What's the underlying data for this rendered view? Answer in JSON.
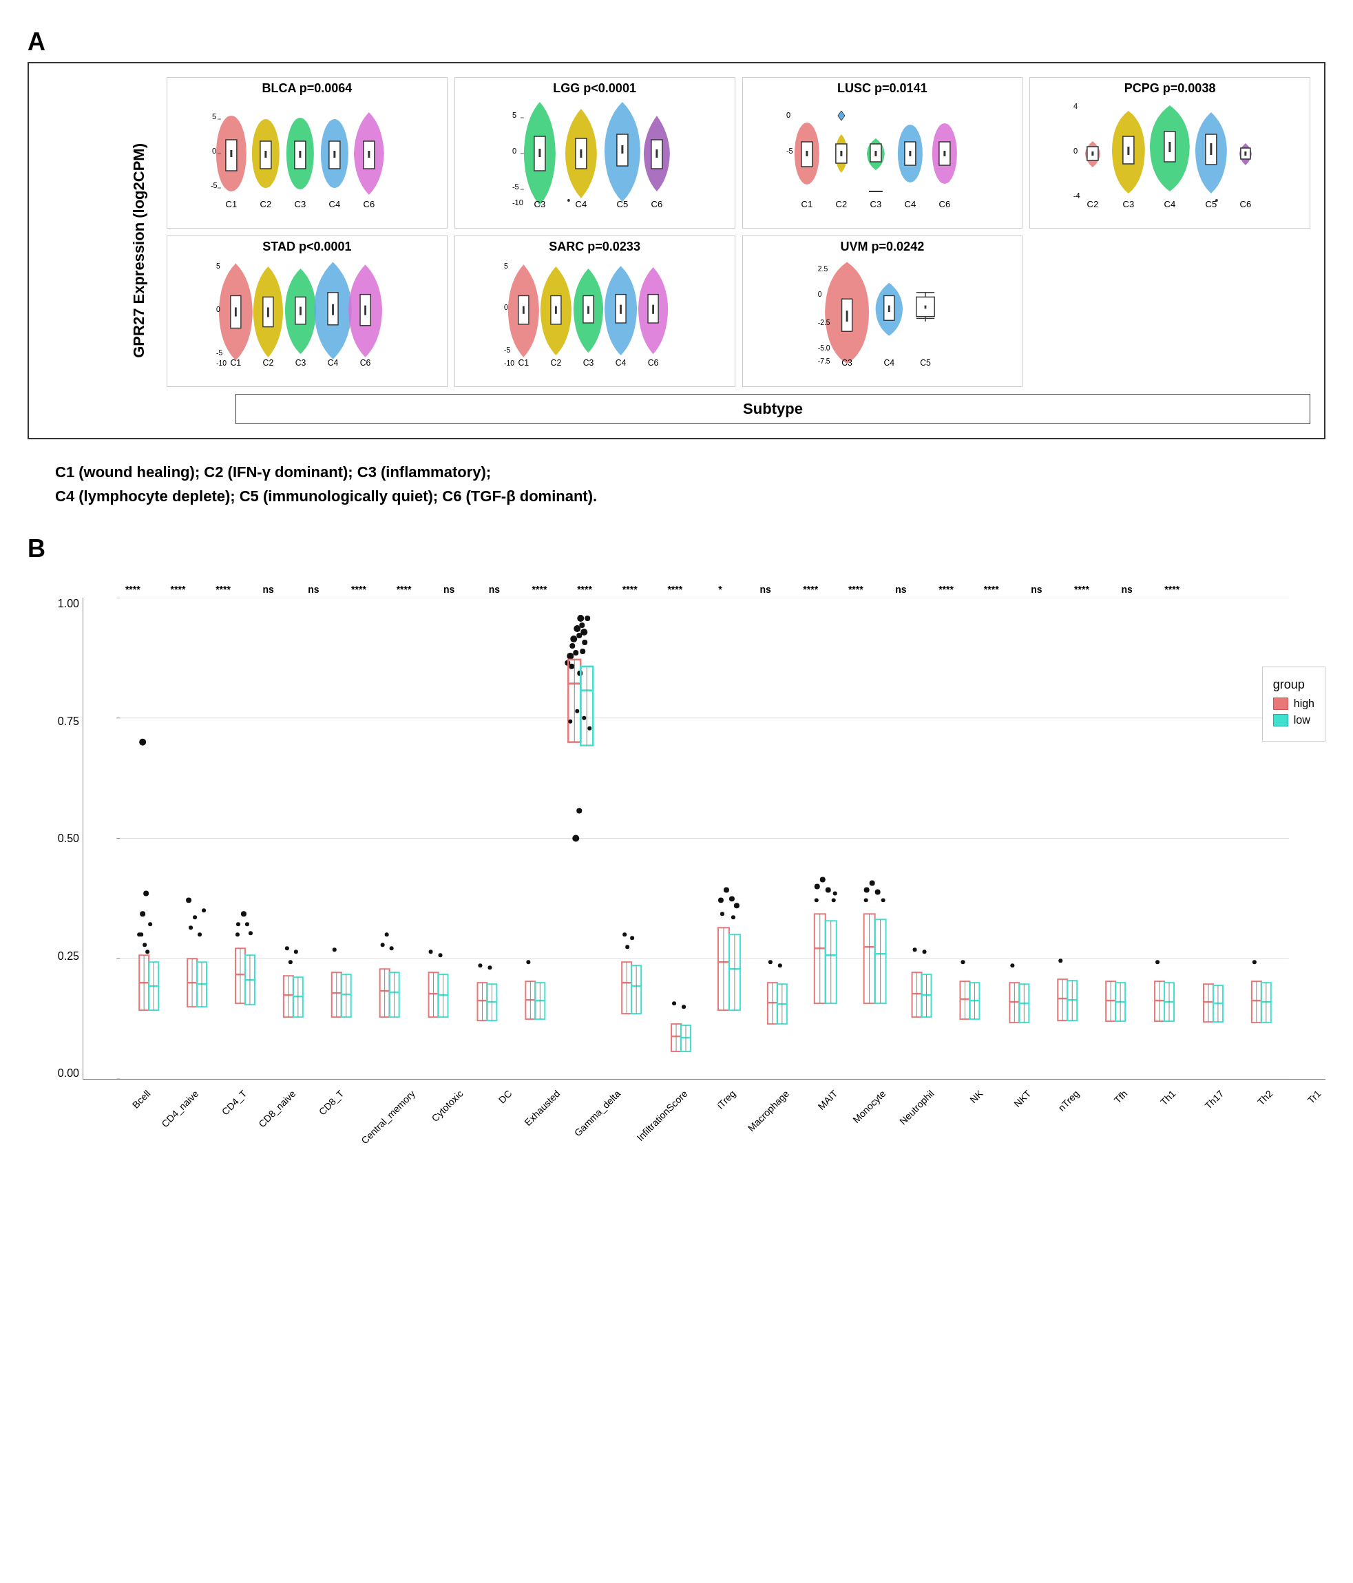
{
  "panelA": {
    "label": "A",
    "yAxisLabel": "GPR27 Expression (log2CPM)",
    "xAxisLabel": "Subtype",
    "plots": [
      {
        "id": "blca",
        "title": "BLCA p=0.0064",
        "xLabels": [
          "C1",
          "C2",
          "C3",
          "C4",
          "C6"
        ],
        "colors": [
          "#E87878",
          "#D4A017",
          "#2ECC71",
          "#5DADE2",
          "#DA70D6"
        ]
      },
      {
        "id": "lgg",
        "title": "LGG p<0.0001",
        "xLabels": [
          "C3",
          "C4",
          "C5",
          "C6"
        ],
        "colors": [
          "#2ECC71",
          "#D4A017",
          "#5DADE2",
          "#9B59B6"
        ]
      },
      {
        "id": "lusc",
        "title": "LUSC p=0.0141",
        "xLabels": [
          "C1",
          "C2",
          "C3",
          "C4",
          "C6"
        ],
        "colors": [
          "#E87878",
          "#D4A017",
          "#2ECC71",
          "#5DADE2",
          "#DA70D6"
        ]
      },
      {
        "id": "pcpg",
        "title": "PCPG p=0.0038",
        "xLabels": [
          "C2",
          "C3",
          "C4",
          "C5",
          "C6"
        ],
        "colors": [
          "#D4A017",
          "#2ECC71",
          "#5DADE2",
          "#9B59B6",
          "#DA70D6"
        ]
      },
      {
        "id": "stad",
        "title": "STAD p<0.0001",
        "xLabels": [
          "C1",
          "C2",
          "C3",
          "C4",
          "C6"
        ],
        "colors": [
          "#E87878",
          "#D4A017",
          "#2ECC71",
          "#5DADE2",
          "#DA70D6"
        ]
      },
      {
        "id": "sarc",
        "title": "SARC p=0.0233",
        "xLabels": [
          "C1",
          "C2",
          "C3",
          "C4",
          "C6"
        ],
        "colors": [
          "#E87878",
          "#D4A017",
          "#2ECC71",
          "#5DADE2",
          "#DA70D6"
        ]
      },
      {
        "id": "uvm",
        "title": "UVM p=0.0242",
        "xLabels": [
          "C3",
          "C4",
          "C5"
        ],
        "colors": [
          "#E87878",
          "#5DADE2",
          "#9B59B6"
        ]
      }
    ],
    "subtypeLabel": "Subtype",
    "legend": "C1 (wound healing); C2 (IFN-γ dominant); C3 (inflammatory);\nC4 (lymphocyte deplete); C5 (immunologically quiet); C6 (TGF-β dominant)."
  },
  "panelB": {
    "label": "B",
    "significance": [
      "****",
      "****",
      "****",
      "ns",
      "ns",
      "****",
      "****",
      "ns",
      "ns",
      "****",
      "****",
      "****",
      "****",
      "*",
      "ns",
      "****",
      "****",
      "ns",
      "****",
      "****",
      "ns",
      "****",
      "ns",
      "****"
    ],
    "xLabels": [
      "Bcell",
      "CD4_naive",
      "CD4_T",
      "CD8_naive",
      "CD8_T",
      "Central_memory",
      "Cytotoxic",
      "DC",
      "Exhausted",
      "Gamma_delta",
      "InfiltrationScore",
      "iTreg",
      "Macrophage",
      "MAIT",
      "Monocyte",
      "Neutrophil",
      "NK",
      "NKT",
      "nTreg",
      "Tfh",
      "Th1",
      "Th17",
      "Th2",
      "Tr1"
    ],
    "yTicks": [
      "0.00",
      "0.25",
      "0.50",
      "0.75"
    ],
    "legend": {
      "title": "group",
      "items": [
        {
          "label": "high",
          "color": "#E87878"
        },
        {
          "label": "low",
          "color": "#40E0D0"
        }
      ]
    }
  }
}
